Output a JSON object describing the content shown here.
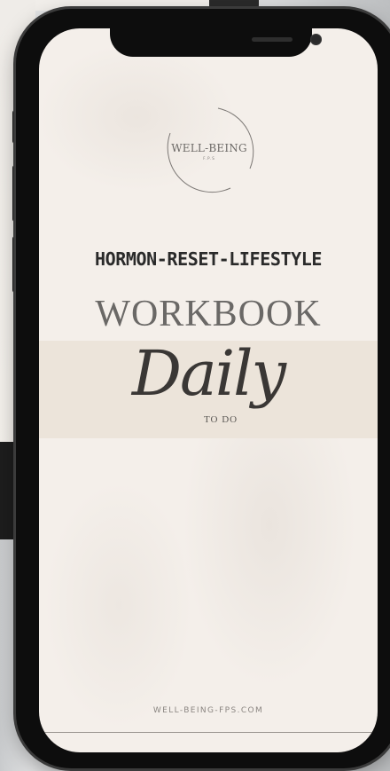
{
  "logo": {
    "brand": "WELL-BEING",
    "sub": "F.P.S"
  },
  "cover": {
    "headline": "HORMON-RESET-LIFESTYLE",
    "subtitle": "WORKBOOK",
    "script_word": "Daily",
    "script_sub": "TO DO",
    "footer_url": "WELL-BEING-FPS.COM"
  },
  "colors": {
    "screen_bg": "#f4efea",
    "band_bg": "#ece4da",
    "headline": "#2a2a2a",
    "phone_frame": "#0d0d0d"
  }
}
